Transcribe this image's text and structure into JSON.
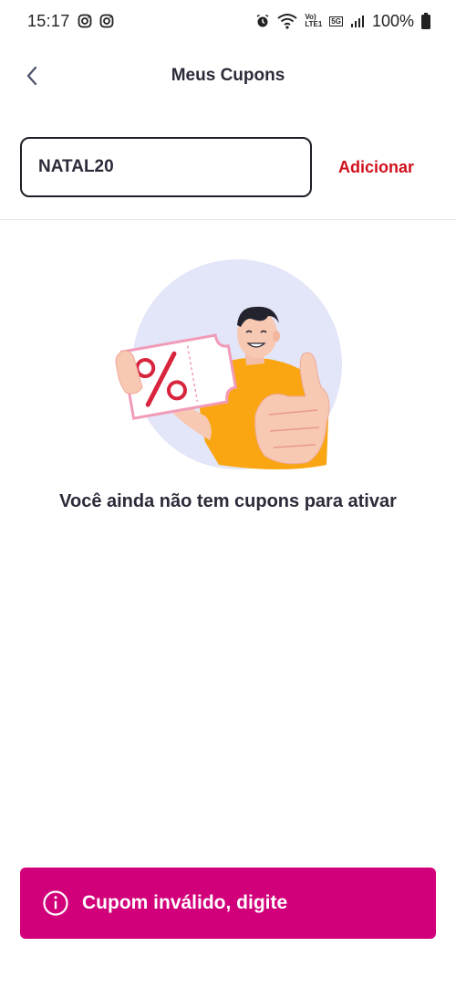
{
  "status_bar": {
    "time": "15:17",
    "battery": "100%",
    "network_labels": [
      "Vo)",
      "LTE1",
      "5G"
    ]
  },
  "header": {
    "title": "Meus Cupons"
  },
  "coupon": {
    "value": "NATAL20",
    "add_label": "Adicionar"
  },
  "empty_state": {
    "message": "Você ainda não tem cupons para ativar"
  },
  "toast": {
    "message": "Cupom inválido, digite"
  },
  "colors": {
    "accent_red": "#d0101c",
    "toast_magenta": "#d1007a",
    "illustration_circle": "#e3e5f8",
    "shirt_orange": "#f9a612"
  }
}
